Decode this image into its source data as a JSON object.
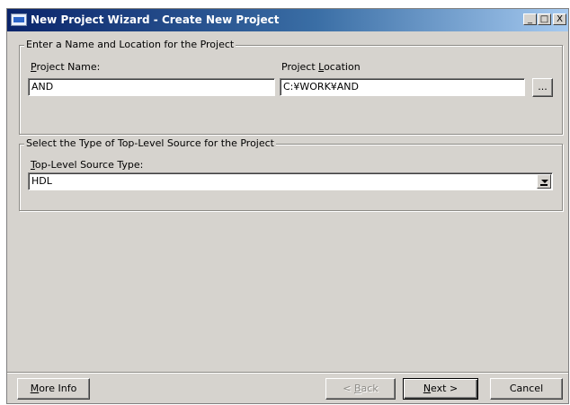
{
  "window": {
    "title": "New Project Wizard - Create New Project",
    "controls": {
      "minimize": "_",
      "maximize": "□",
      "close": "X"
    }
  },
  "name_location": {
    "group_label": "Enter a Name and Location for the Project",
    "project_name_label_accel": "P",
    "project_name_label_rest": "roject Name:",
    "project_name_value": "AND",
    "project_location_label_pre": "Project ",
    "project_location_label_accel": "L",
    "project_location_label_rest": "ocation",
    "project_location_value": "C:¥WORK¥AND",
    "browse_label": "..."
  },
  "source_type": {
    "group_label": "Select the Type of Top-Level Source for the Project",
    "label_accel": "T",
    "label_rest": "op-Level Source Type:",
    "selected": "HDL"
  },
  "footer": {
    "more_info_accel": "M",
    "more_info_rest": "ore Info",
    "back_pre": "< ",
    "back_accel": "B",
    "back_rest": "ack",
    "next_accel": "N",
    "next_rest": "ext >",
    "cancel": "Cancel"
  }
}
